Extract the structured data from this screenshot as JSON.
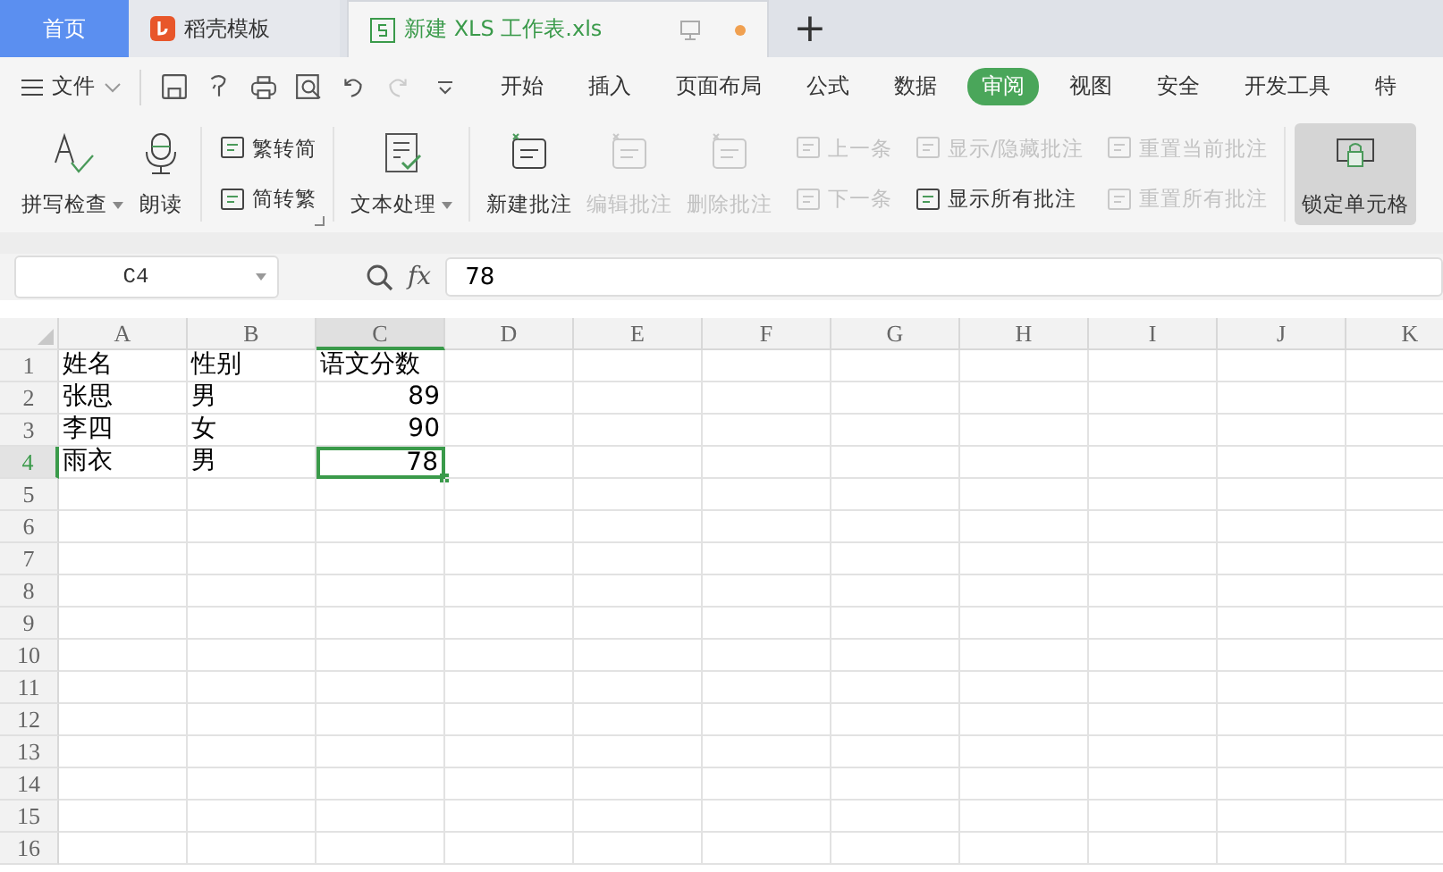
{
  "tabs": [
    {
      "label": "首页",
      "kind": "home",
      "selected": false
    },
    {
      "label": "稻壳模板",
      "kind": "template",
      "selected": false
    },
    {
      "label": "新建 XLS 工作表.xls",
      "kind": "sheet",
      "selected": true,
      "unsaved": true
    }
  ],
  "new_tab": "+",
  "menu": {
    "file": "文件",
    "items": [
      {
        "label": "开始",
        "selected": false
      },
      {
        "label": "插入",
        "selected": false
      },
      {
        "label": "页面布局",
        "selected": false
      },
      {
        "label": "公式",
        "selected": false
      },
      {
        "label": "数据",
        "selected": false
      },
      {
        "label": "审阅",
        "selected": true
      },
      {
        "label": "视图",
        "selected": false
      },
      {
        "label": "安全",
        "selected": false
      },
      {
        "label": "开发工具",
        "selected": false
      },
      {
        "label": "特",
        "selected": false
      }
    ]
  },
  "ribbon": [
    {
      "kind": "big",
      "items": [
        {
          "label": "拼写检查",
          "dropdown": true,
          "disabled": false
        },
        {
          "label": "朗读",
          "dropdown": false,
          "disabled": false
        }
      ]
    },
    {
      "kind": "small",
      "launcher": true,
      "items": [
        {
          "label": "繁转简",
          "disabled": false
        },
        {
          "label": "简转繁",
          "disabled": false
        }
      ]
    },
    {
      "kind": "big",
      "items": [
        {
          "label": "文本处理",
          "dropdown": true,
          "disabled": false
        }
      ]
    },
    {
      "kind": "big",
      "items": [
        {
          "label": "新建批注",
          "dropdown": false,
          "disabled": false
        },
        {
          "label": "编辑批注",
          "dropdown": false,
          "disabled": true
        },
        {
          "label": "删除批注",
          "dropdown": false,
          "disabled": true
        }
      ]
    },
    {
      "kind": "small",
      "items": [
        {
          "label": "上一条",
          "disabled": true
        },
        {
          "label": "下一条",
          "disabled": true
        }
      ]
    },
    {
      "kind": "small",
      "items": [
        {
          "label": "显示/隐藏批注",
          "disabled": true
        },
        {
          "label": "显示所有批注",
          "disabled": false
        }
      ]
    },
    {
      "kind": "small",
      "items": [
        {
          "label": "重置当前批注",
          "disabled": true
        },
        {
          "label": "重置所有批注",
          "disabled": true
        }
      ]
    },
    {
      "kind": "big",
      "items": [
        {
          "label": "锁定单元格",
          "dropdown": false,
          "disabled": false,
          "selected": true
        }
      ]
    }
  ],
  "formula_bar": {
    "name_box": "C4",
    "fx": "fx",
    "value": "78"
  },
  "sheet": {
    "columns": [
      {
        "label": "A",
        "selected": false
      },
      {
        "label": "B",
        "selected": false
      },
      {
        "label": "C",
        "selected": true
      },
      {
        "label": "D",
        "selected": false
      },
      {
        "label": "E",
        "selected": false
      },
      {
        "label": "F",
        "selected": false
      },
      {
        "label": "G",
        "selected": false
      },
      {
        "label": "H",
        "selected": false
      },
      {
        "label": "I",
        "selected": false
      },
      {
        "label": "J",
        "selected": false
      },
      {
        "label": "K",
        "selected": false
      }
    ],
    "rows": [
      {
        "number": "1",
        "selected": false,
        "cells": [
          {
            "text": "姓名",
            "kind": "text",
            "selected": false
          },
          {
            "text": "性别",
            "kind": "text",
            "selected": false
          },
          {
            "text": "语文分数",
            "kind": "text",
            "selected": false
          }
        ]
      },
      {
        "number": "2",
        "selected": false,
        "cells": [
          {
            "text": "张思",
            "kind": "text",
            "selected": false
          },
          {
            "text": "男",
            "kind": "text",
            "selected": false
          },
          {
            "text": "89",
            "kind": "number",
            "selected": false
          }
        ]
      },
      {
        "number": "3",
        "selected": false,
        "cells": [
          {
            "text": "李四",
            "kind": "text",
            "selected": false
          },
          {
            "text": "女",
            "kind": "text",
            "selected": false
          },
          {
            "text": "90",
            "kind": "number",
            "selected": false
          }
        ]
      },
      {
        "number": "4",
        "selected": true,
        "cells": [
          {
            "text": "雨衣",
            "kind": "text",
            "selected": false
          },
          {
            "text": "男",
            "kind": "text",
            "selected": false
          },
          {
            "text": "78",
            "kind": "number",
            "selected": true
          }
        ]
      },
      {
        "number": "5",
        "selected": false,
        "cells": []
      },
      {
        "number": "6",
        "selected": false,
        "cells": []
      },
      {
        "number": "7",
        "selected": false,
        "cells": []
      },
      {
        "number": "8",
        "selected": false,
        "cells": []
      },
      {
        "number": "9",
        "selected": false,
        "cells": []
      },
      {
        "number": "10",
        "selected": false,
        "cells": []
      },
      {
        "number": "11",
        "selected": false,
        "cells": []
      },
      {
        "number": "12",
        "selected": false,
        "cells": []
      },
      {
        "number": "13",
        "selected": false,
        "cells": []
      },
      {
        "number": "14",
        "selected": false,
        "cells": []
      },
      {
        "number": "15",
        "selected": false,
        "cells": []
      },
      {
        "number": "16",
        "selected": false,
        "cells": []
      }
    ]
  }
}
